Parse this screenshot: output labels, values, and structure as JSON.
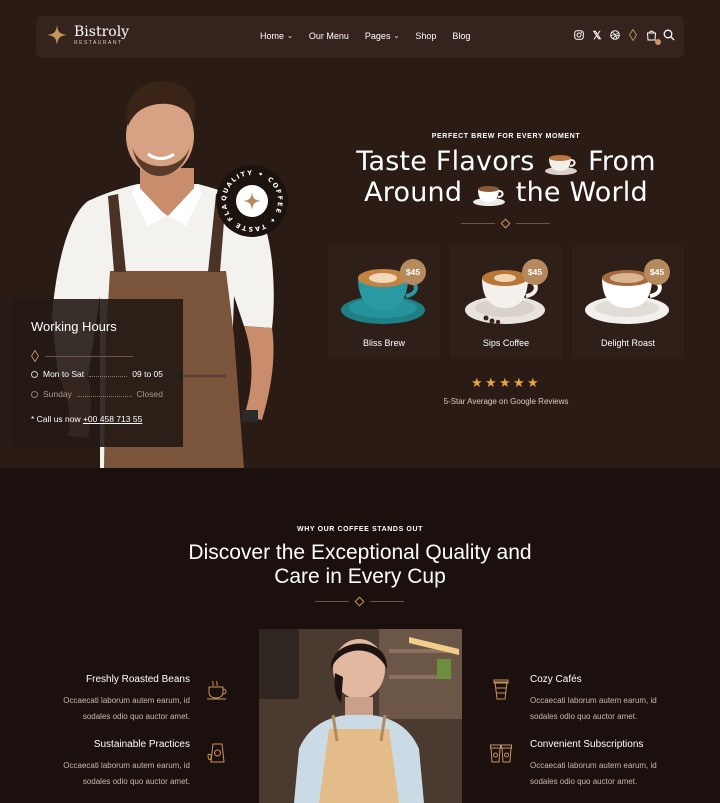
{
  "brand": {
    "name": "Bistroly",
    "tagline": "RESTAURANT",
    "accent": "#c8955f"
  },
  "nav": {
    "items": [
      {
        "label": "Home",
        "dropdown": true
      },
      {
        "label": "Our Menu",
        "dropdown": false
      },
      {
        "label": "Pages",
        "dropdown": true
      },
      {
        "label": "Shop",
        "dropdown": false
      },
      {
        "label": "Blog",
        "dropdown": false
      }
    ],
    "icons": [
      "instagram-icon",
      "x-icon",
      "dribbble-icon",
      "diamond-icon",
      "cart-icon",
      "search-icon"
    ]
  },
  "badge": {
    "text": "QUALITY ✦ COFFEE ✦ TASTE FLAVORS ✦"
  },
  "hours": {
    "title": "Working Hours",
    "rows": [
      {
        "day": "Mon to Sat",
        "time": "09 to 05"
      },
      {
        "day": "Sunday",
        "time": "Closed"
      }
    ],
    "call_prefix": "* Call us now ",
    "phone": "+00 458 713 55"
  },
  "hero": {
    "eyebrow": "PERFECT BREW FOR EVERY MOMENT",
    "title_line1_a": "Taste Flavors",
    "title_line1_b": "From",
    "title_line2_a": "Around",
    "title_line2_b": "the World"
  },
  "products": [
    {
      "name": "Bliss Brew",
      "price": "$45",
      "saucer": "#1f7f86"
    },
    {
      "name": "Sips Coffee",
      "price": "$45",
      "saucer": "#e9e4de"
    },
    {
      "name": "Delight Roast",
      "price": "$45",
      "saucer": "#f2efec"
    }
  ],
  "rating": {
    "stars": 5,
    "text": "5-Star Average on Google Reviews"
  },
  "section2": {
    "eyebrow": "WHY OUR COFFEE STANDS OUT",
    "title_line1": "Discover the Exceptional Quality and",
    "title_line2": "Care in Every Cup",
    "features_left": [
      {
        "title": "Freshly Roasted Beans",
        "desc1": "Occaecati laborum autem earum, id",
        "desc2": "sodales odio quo auctor amet.",
        "icon": "coffee-cup-icon"
      },
      {
        "title": "Sustainable Practices",
        "desc1": "Occaecati laborum autem earum, id",
        "desc2": "sodales odio quo auctor amet.",
        "icon": "coffee-bag-icon"
      }
    ],
    "features_right": [
      {
        "title": "Cozy Cafés",
        "desc1": "Occaecati laborum autem earum, id",
        "desc2": "sodales odio quo auctor amet.",
        "icon": "takeaway-cup-icon"
      },
      {
        "title": "Convenient Subscriptions",
        "desc1": "Occaecati laborum autem earum, id",
        "desc2": "sodales odio quo auctor amet.",
        "icon": "cups-icon"
      }
    ]
  }
}
